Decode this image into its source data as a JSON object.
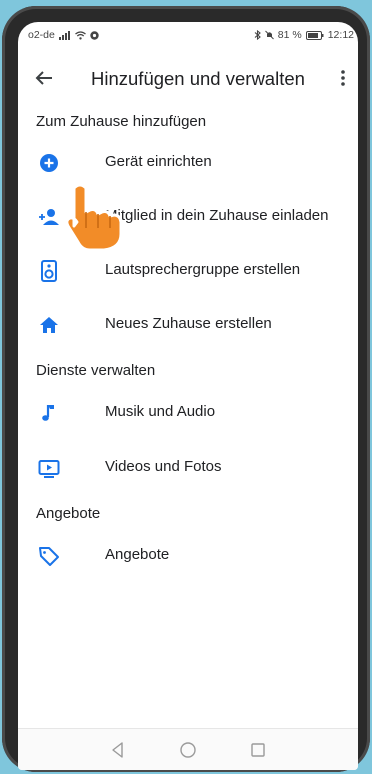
{
  "status_bar": {
    "carrier": "o2-de",
    "battery": "81 %",
    "time": "12:12"
  },
  "header": {
    "title": "Hinzufügen und verwalten"
  },
  "sections": [
    {
      "title": "Zum Zuhause hinzufügen",
      "items": [
        {
          "label": "Gerät einrichten",
          "icon": "add-circle-icon"
        },
        {
          "label": "Mitglied in dein Zuhause einladen",
          "icon": "person-add-icon"
        },
        {
          "label": "Lautsprechergruppe erstellen",
          "icon": "speaker-icon"
        },
        {
          "label": "Neues Zuhause erstellen",
          "icon": "home-icon"
        }
      ]
    },
    {
      "title": "Dienste verwalten",
      "items": [
        {
          "label": "Musik und Audio",
          "icon": "music-note-icon"
        },
        {
          "label": "Videos und Fotos",
          "icon": "video-icon"
        }
      ]
    },
    {
      "title": "Angebote",
      "items": [
        {
          "label": "Angebote",
          "icon": "tag-icon"
        }
      ]
    }
  ],
  "colors": {
    "accent": "#1a73e8",
    "pointer": "#f28c28"
  }
}
